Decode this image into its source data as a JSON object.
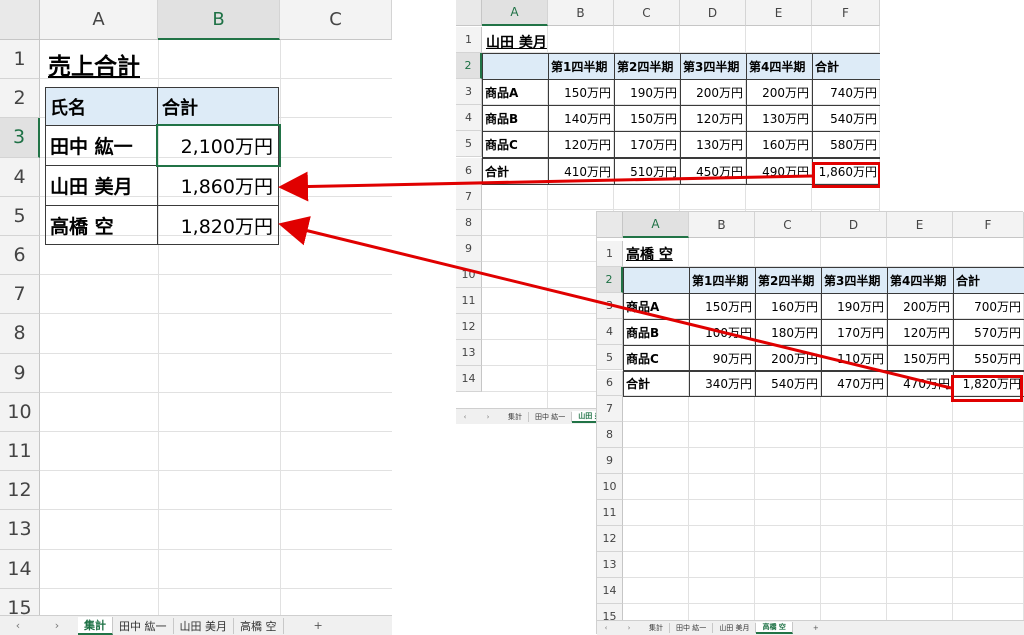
{
  "summary_sheet": {
    "columns": [
      "A",
      "B",
      "C"
    ],
    "rows": [
      "1",
      "2",
      "3",
      "4",
      "5",
      "6",
      "7",
      "8",
      "9",
      "10",
      "11",
      "12",
      "13",
      "14",
      "15"
    ],
    "title": "売上合計",
    "header": {
      "name": "氏名",
      "total": "合計"
    },
    "people": [
      {
        "name": "田中 紘一",
        "total": "2,100万円"
      },
      {
        "name": "山田 美月",
        "total": "1,860万円"
      },
      {
        "name": "高橋 空",
        "total": "1,820万円"
      }
    ],
    "tabs": [
      "集計",
      "田中 紘一",
      "山田 美月",
      "高橋 空"
    ],
    "active_tab": "集計",
    "add_sheet": "+"
  },
  "yamada_sheet": {
    "columns": [
      "A",
      "B",
      "C",
      "D",
      "E",
      "F"
    ],
    "rows": [
      "1",
      "2",
      "3",
      "4",
      "5",
      "6",
      "7",
      "8",
      "9",
      "10",
      "11",
      "12",
      "13",
      "14"
    ],
    "title": "山田 美月",
    "header": [
      "",
      "第1四半期",
      "第2四半期",
      "第3四半期",
      "第4四半期",
      "合計"
    ],
    "body": [
      [
        "商品A",
        "150万円",
        "190万円",
        "200万円",
        "200万円",
        "740万円"
      ],
      [
        "商品B",
        "140万円",
        "150万円",
        "120万円",
        "130万円",
        "540万円"
      ],
      [
        "商品C",
        "120万円",
        "170万円",
        "130万円",
        "160万円",
        "580万円"
      ],
      [
        "合計",
        "410万円",
        "510万円",
        "450万円",
        "490万円",
        "1,860万円"
      ]
    ],
    "tabs": [
      "集計",
      "田中 紘一",
      "山田 美月"
    ],
    "active_tab": "山田 美月"
  },
  "takahashi_sheet": {
    "columns": [
      "A",
      "B",
      "C",
      "D",
      "E",
      "F"
    ],
    "rows": [
      "1",
      "2",
      "3",
      "4",
      "5",
      "6",
      "7",
      "8",
      "9",
      "10",
      "11",
      "12",
      "13",
      "14",
      "15"
    ],
    "title": "高橋 空",
    "header": [
      "",
      "第1四半期",
      "第2四半期",
      "第3四半期",
      "第4四半期",
      "合計"
    ],
    "body": [
      [
        "商品A",
        "150万円",
        "160万円",
        "190万円",
        "200万円",
        "700万円"
      ],
      [
        "商品B",
        "100万円",
        "180万円",
        "170万円",
        "120万円",
        "570万円"
      ],
      [
        "商品C",
        "90万円",
        "200万円",
        "110万円",
        "150万円",
        "550万円"
      ],
      [
        "合計",
        "340万円",
        "540万円",
        "470万円",
        "470万円",
        "1,820万円"
      ]
    ],
    "tabs": [
      "集計",
      "田中 紘一",
      "山田 美月",
      "高橋 空"
    ],
    "active_tab": "高橋 空",
    "add_sheet": "+"
  },
  "colors": {
    "highlight": "#e00000",
    "header_fill": "#ddebf7",
    "excel_green": "#217346"
  }
}
